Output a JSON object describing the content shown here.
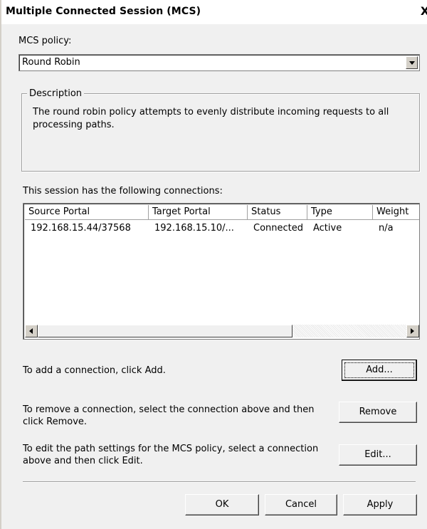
{
  "window": {
    "title": "Multiple Connected Session (MCS)",
    "close_glyph": "X"
  },
  "policy": {
    "label": "MCS policy:",
    "selected": "Round Robin"
  },
  "description": {
    "legend": "Description",
    "text": "The round robin policy attempts to evenly distribute incoming requests to all processing paths."
  },
  "connections": {
    "label": "This session has the following connections:",
    "columns": [
      "Source Portal",
      "Target Portal",
      "Status",
      "Type",
      "Weight"
    ],
    "rows": [
      [
        "192.168.15.44/37568",
        "192.168.15.10/...",
        "Connected",
        "Active",
        "n/a"
      ]
    ]
  },
  "actions": {
    "add_hint": "To add a connection, click Add.",
    "add_label": "Add...",
    "remove_hint": "To remove a connection, select the connection above and then click Remove.",
    "remove_label": "Remove",
    "edit_hint": "To edit the path settings for the MCS policy, select a connection above and then click Edit.",
    "edit_label": "Edit..."
  },
  "footer": {
    "ok_label": "OK",
    "cancel_label": "Cancel",
    "apply_label": "Apply"
  },
  "icons": {
    "combo_arrow": "chevron-down-icon",
    "scroll_left": "triangle-left-icon",
    "scroll_right": "triangle-right-icon",
    "close": "close-icon"
  }
}
